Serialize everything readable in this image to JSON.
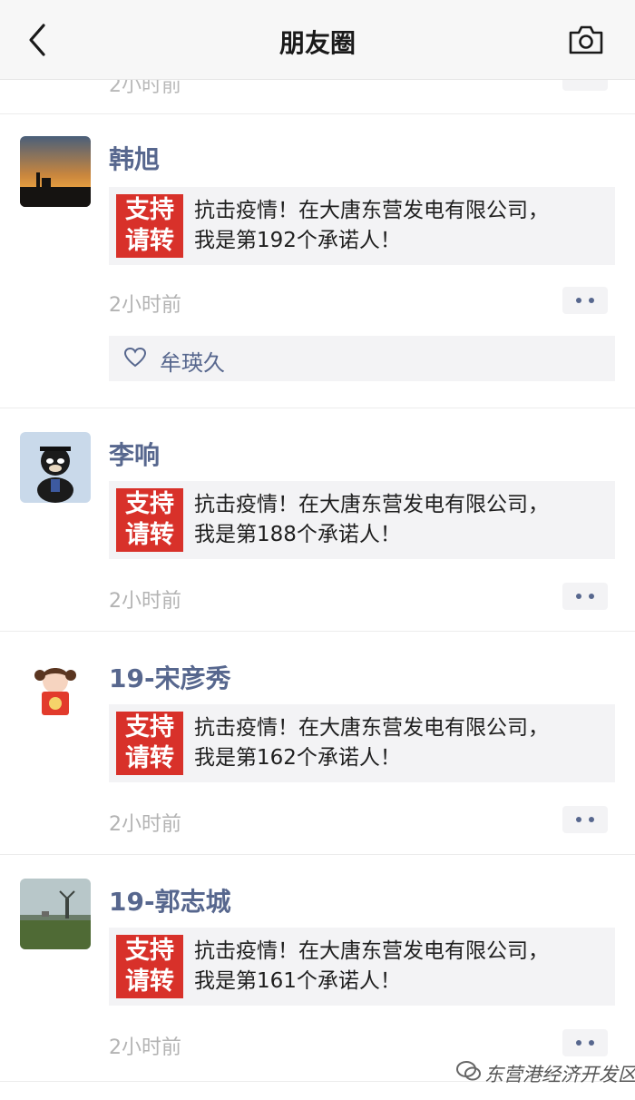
{
  "nav": {
    "title": "朋友圈",
    "back_icon": "chevron-left-icon",
    "camera_icon": "camera-icon"
  },
  "previous_post": {
    "time": "2小时前"
  },
  "posts": [
    {
      "author": "韩旭",
      "thumb_line1": "支持",
      "thumb_line2": "请转",
      "text_line1": "抗击疫情！在大唐东营发电有限公司，",
      "text_line2": "我是第192个承诺人！",
      "time": "2小时前",
      "like_name": "牟瑛久"
    },
    {
      "author": "李响",
      "thumb_line1": "支持",
      "thumb_line2": "请转",
      "text_line1": "抗击疫情！在大唐东营发电有限公司，",
      "text_line2": "我是第188个承诺人！",
      "time": "2小时前"
    },
    {
      "author": "19-宋彦秀",
      "thumb_line1": "支持",
      "thumb_line2": "请转",
      "text_line1": "抗击疫情！在大唐东营发电有限公司，",
      "text_line2": "我是第162个承诺人！",
      "time": "2小时前"
    },
    {
      "author": "19-郭志城",
      "thumb_line1": "支持",
      "thumb_line2": "请转",
      "text_line1": "抗击疫情！在大唐东营发电有限公司，",
      "text_line2": "我是第161个承诺人！",
      "time": "2小时前"
    }
  ],
  "watermark": {
    "text": "东营港经济开发区"
  },
  "colors": {
    "author_blue": "#57678e",
    "share_red": "#d8312a",
    "card_bg": "#f3f3f5"
  }
}
